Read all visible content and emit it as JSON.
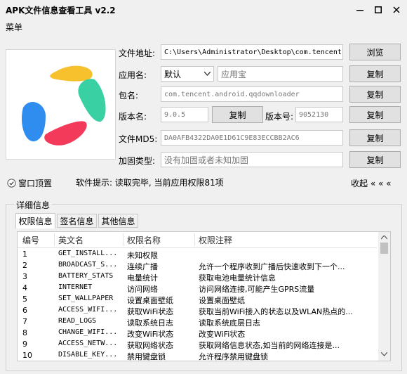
{
  "window": {
    "title": "APK文件信息查看工具 v2.2",
    "menu_label": "菜单"
  },
  "form": {
    "file_path_label": "文件地址:",
    "file_path_value": "C:\\Users\\Administrator\\Desktop\\com.tencent",
    "browse_label": "浏览",
    "app_name_label": "应用名:",
    "language_select": "默认",
    "app_name_value": "应用宝",
    "package_label": "包名:",
    "package_value": "com.tencent.android.qqdownloader",
    "version_name_label": "版本名:",
    "version_name_value": "9.0.5",
    "version_code_label": "版本号:",
    "version_code_value": "9052130",
    "md5_label": "文件MD5:",
    "md5_value": "DA0AFB4322DA0E1D61C9E83ECCBB2AC6",
    "protect_label": "加固类型:",
    "protect_value": "没有加固或者未知加固",
    "copy_label": "复制"
  },
  "pin_window_label": "窗口顶置",
  "hint_text": "软件提示: 读取完毕, 当前应用权限81项",
  "collapse_label": "收起 « « «",
  "details": {
    "group_label": "详细信息",
    "tabs": [
      "权限信息",
      "签名信息",
      "其他信息"
    ],
    "columns": [
      "编号",
      "英文名",
      "权限名称",
      "权限注释"
    ],
    "rows": [
      [
        "1",
        "GET_INSTALL...",
        "未知权限",
        ""
      ],
      [
        "2",
        "BROADCAST_S...",
        "连续广播",
        "允许一个程序收到广播后快速收到下一个..."
      ],
      [
        "3",
        "BATTERY_STATS",
        "电量统计",
        "获取电池电量统计信息"
      ],
      [
        "4",
        "INTERNET",
        "访问网络",
        "访问网络连接,可能产生GPRS流量"
      ],
      [
        "5",
        "SET_WALLPAPER",
        "设置桌面壁纸",
        "设置桌面壁纸"
      ],
      [
        "6",
        "ACCESS_WIFI...",
        "获取WiFi状态",
        "获取当前WiFi接入的状态以及WLAN热点的..."
      ],
      [
        "7",
        "READ_LOGS",
        "读取系统日志",
        "读取系统底层日志"
      ],
      [
        "8",
        "CHANGE_WIFI...",
        "改变WiFi状态",
        "改变WiFi状态"
      ],
      [
        "9",
        "ACCESS_NETW...",
        "获取网络状态",
        "获取网络信息状态,如当前的网络连接是..."
      ],
      [
        "10",
        "DISABLE_KEY...",
        "禁用键盘锁",
        "允许程序禁用键盘锁"
      ]
    ]
  }
}
